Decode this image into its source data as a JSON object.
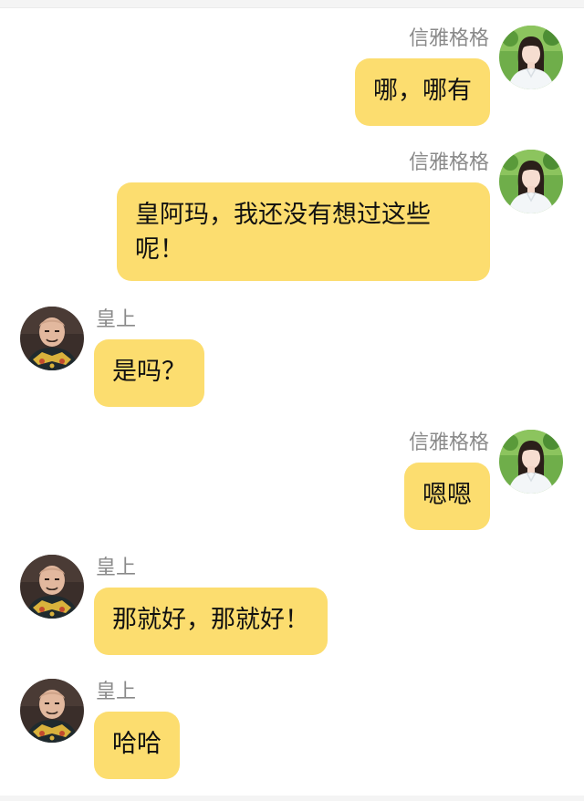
{
  "chat": {
    "messages": [
      {
        "side": "right",
        "sender": "信雅格格",
        "avatar": "young-woman-avatar",
        "text": "哪，哪有"
      },
      {
        "side": "right",
        "sender": "信雅格格",
        "avatar": "young-woman-avatar",
        "text": "皇阿玛，我还没有想过这些呢！"
      },
      {
        "side": "left",
        "sender": "皇上",
        "avatar": "emperor-avatar",
        "text": "是吗？"
      },
      {
        "side": "right",
        "sender": "信雅格格",
        "avatar": "young-woman-avatar",
        "text": "嗯嗯"
      },
      {
        "side": "left",
        "sender": "皇上",
        "avatar": "emperor-avatar",
        "text": "那就好，那就好！"
      },
      {
        "side": "left",
        "sender": "皇上",
        "avatar": "emperor-avatar",
        "text": "哈哈"
      }
    ]
  },
  "colors": {
    "bubble": "#fcdd6f",
    "sender_text": "#8a8a8a",
    "message_text": "#111111",
    "background": "#ffffff"
  }
}
